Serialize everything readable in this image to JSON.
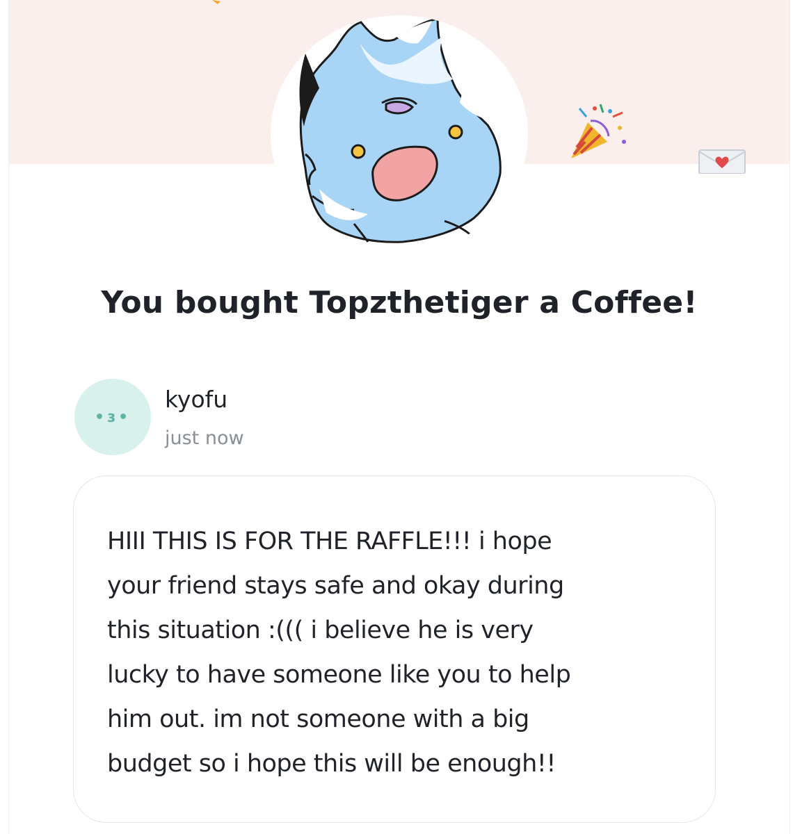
{
  "header": {
    "creator_avatar_alt": "Topzthetiger avatar",
    "decorations": {
      "left_icon": "party-popper-icon",
      "right_icon": "heart-envelope-icon"
    }
  },
  "main": {
    "title": "You bought Topzthetiger a Coffee!"
  },
  "supporter": {
    "avatar_face": "•ɜ•",
    "name": "kyofu",
    "time": "just now"
  },
  "message": {
    "text": "HIII THIS IS FOR THE RAFFLE!!! i hope\nyour friend stays safe and okay during\nthis situation :((( i believe he is very\nlucky to have someone like you to help\nhim out. im not someone with a big\nbudget so i hope this will be enough!!"
  },
  "colors": {
    "header_band": "#fbefee",
    "title_text": "#1f2329",
    "muted_text": "#8a8f96",
    "supporter_avatar_bg": "#d8f1ec",
    "supporter_avatar_fg": "#5fb4a6",
    "message_border": "#e4e6e9"
  }
}
